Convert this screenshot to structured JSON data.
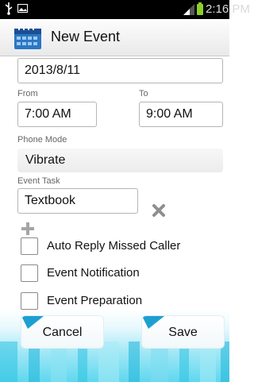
{
  "status_bar": {
    "time": "2:16 PM",
    "icons": [
      "usb-icon",
      "image-icon",
      "signal-icon",
      "battery-icon"
    ]
  },
  "header": {
    "title": "New Event",
    "icon": "calendar-icon"
  },
  "form": {
    "date": "2013/8/11",
    "from_label": "From",
    "to_label": "To",
    "from_time": "7:00 AM",
    "to_time": "9:00 AM",
    "phone_mode_label": "Phone Mode",
    "phone_mode_value": "Vibrate",
    "event_task_label": "Event Task",
    "event_task_value": "Textbook",
    "checkboxes": [
      {
        "label": "Auto Reply Missed Caller",
        "checked": false
      },
      {
        "label": "Event Notification",
        "checked": false
      },
      {
        "label": "Event Preparation",
        "checked": false
      }
    ]
  },
  "actions": {
    "cancel": "Cancel",
    "save": "Save"
  },
  "colors": {
    "accent": "#1e9fd1",
    "battery": "#8ccf2a",
    "bottom_tint": "#5fd7ee"
  }
}
